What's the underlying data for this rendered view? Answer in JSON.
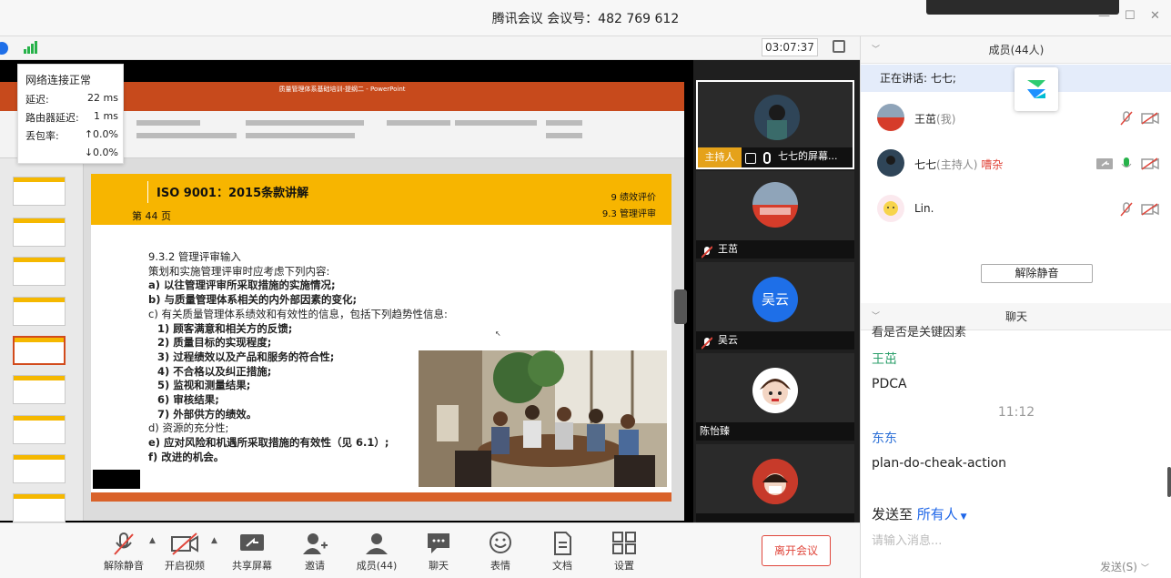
{
  "window": {
    "title": "腾讯会议 会议号：482 769 612"
  },
  "subbar": {
    "timer": "03:07:37"
  },
  "net_popup": {
    "title": "网络连接正常",
    "rows": [
      {
        "label": "延迟:",
        "value": "22 ms"
      },
      {
        "label": "路由器延迟:",
        "value": "1 ms"
      },
      {
        "label": "丢包率:",
        "value": "↑0.0%"
      },
      {
        "label": "",
        "value": "↓0.0%"
      }
    ]
  },
  "ppt": {
    "window_title": "质量管理体系基础培训-提纲二 - PowerPoint",
    "slide": {
      "title": "ISO 9001：2015条款讲解",
      "page": "第 44  页",
      "right1": "9 绩效评价",
      "right2": "9.3 管理评审",
      "lines": [
        {
          "t": "9.3.2 管理评审输入",
          "b": false,
          "ind": false
        },
        {
          "t": "策划和实施管理评审时应考虑下列内容:",
          "b": false,
          "ind": false
        },
        {
          "t": "a) 以往管理评审所采取措施的实施情况;",
          "b": true,
          "ind": false
        },
        {
          "t": "b) 与质量管理体系相关的内外部因素的变化;",
          "b": true,
          "ind": false
        },
        {
          "t": "c) 有关质量管理体系绩效和有效性的信息，包括下列趋势性信息:",
          "b": false,
          "ind": false
        },
        {
          "t": "1) 顾客满意和相关方的反馈;",
          "b": true,
          "ind": true
        },
        {
          "t": "2) 质量目标的实现程度;",
          "b": true,
          "ind": true
        },
        {
          "t": "3) 过程绩效以及产品和服务的符合性;",
          "b": true,
          "ind": true
        },
        {
          "t": "4) 不合格以及纠正措施;",
          "b": true,
          "ind": true
        },
        {
          "t": "5) 监视和测量结果;",
          "b": true,
          "ind": true
        },
        {
          "t": "6) 审核结果;",
          "b": true,
          "ind": true
        },
        {
          "t": "7) 外部供方的绩效。",
          "b": true,
          "ind": true
        },
        {
          "t": "d) 资源的充分性;",
          "b": false,
          "ind": false
        },
        {
          "t": "e) 应对风险和机遇所采取措施的有效性（见 6.1）;",
          "b": true,
          "ind": false
        },
        {
          "t": "f) 改进的机会。",
          "b": true,
          "ind": false
        }
      ]
    }
  },
  "videos": [
    {
      "name": "七七的屏幕...",
      "host_tag": "主持人"
    },
    {
      "name": "王茁"
    },
    {
      "name": "吴云",
      "avatar_text": "吴云"
    },
    {
      "name": "陈怡臻"
    },
    {
      "name": ""
    }
  ],
  "members": {
    "header": "成员(44人)",
    "speaking": "正在讲话: 七七;",
    "list": [
      {
        "name": "王茁",
        "role": "(我)",
        "noise": ""
      },
      {
        "name": "七七",
        "role": "(主持人)",
        "noise": "嘈杂"
      },
      {
        "name": "Lin.",
        "role": "",
        "noise": ""
      }
    ],
    "unmute_all": "解除静音"
  },
  "chat": {
    "header": "聊天",
    "partial": "看是否是关键因素",
    "messages": [
      {
        "sender": "王茁",
        "text": "PDCA"
      },
      {
        "time": "11:12"
      },
      {
        "sender": "东东",
        "text": "plan-do-cheak-action"
      }
    ],
    "send_to_label": "发送至",
    "send_to_target": "所有人",
    "placeholder": "请输入消息...",
    "send": "发送(S)"
  },
  "toolbar": {
    "items": [
      "解除静音",
      "开启视频",
      "共享屏幕",
      "邀请",
      "成员(44)",
      "聊天",
      "表情",
      "文档",
      "设置"
    ],
    "leave": "离开会议"
  },
  "colors": {
    "accent": "#1e66e8",
    "danger": "#e0463b",
    "slide_header": "#f7b500",
    "ppt_bar": "#c74a1c"
  }
}
